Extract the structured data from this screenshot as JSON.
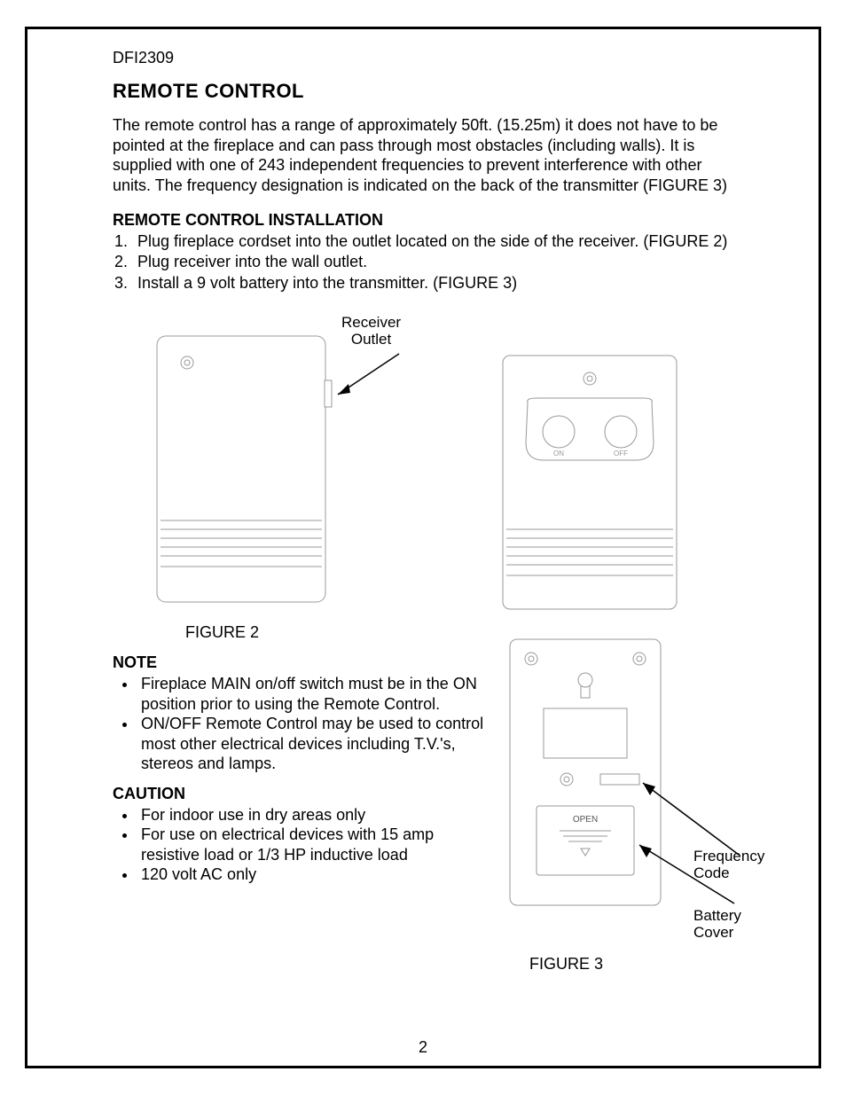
{
  "model": "DFI2309",
  "title": "REMOTE CONTROL",
  "intro": "The remote control has a range of approximately 50ft. (15.25m) it does not have to be pointed at the fireplace and can pass through most obstacles (including walls).  It is supplied with one of 243 independent frequencies to prevent interference with other units.  The frequency designation is indicated on the back of the transmitter (FIGURE 3)",
  "install_heading": "REMOTE CONTROL INSTALLATION",
  "install_steps": {
    "s1": "Plug fireplace cordset into the outlet located on the side of the receiver. (FIGURE 2)",
    "s2": "Plug receiver into the wall outlet.",
    "s3": "Install a 9 volt battery into the transmitter. (FIGURE 3)"
  },
  "labels": {
    "receiver_outlet_1": "Receiver",
    "receiver_outlet_2": "Outlet",
    "figure2": "FIGURE 2",
    "figure3": "FIGURE 3",
    "freq_1": "Frequency",
    "freq_2": "Code",
    "batt_1": "Battery",
    "batt_2": "Cover",
    "on": "ON",
    "off": "OFF",
    "open": "OPEN"
  },
  "note_heading": "NOTE",
  "notes": {
    "n1": "Fireplace MAIN on/off switch must be in the ON position prior to using the Remote Control.",
    "n2": "ON/OFF Remote Control may be used to control most other electrical devices including T.V.'s, stereos and lamps."
  },
  "caution_heading": "CAUTION",
  "cautions": {
    "c1": "For indoor use in dry areas only",
    "c2": "For use on electrical devices with 15 amp resistive load or 1/3 HP inductive load",
    "c3": "120 volt AC only"
  },
  "page_number": "2"
}
